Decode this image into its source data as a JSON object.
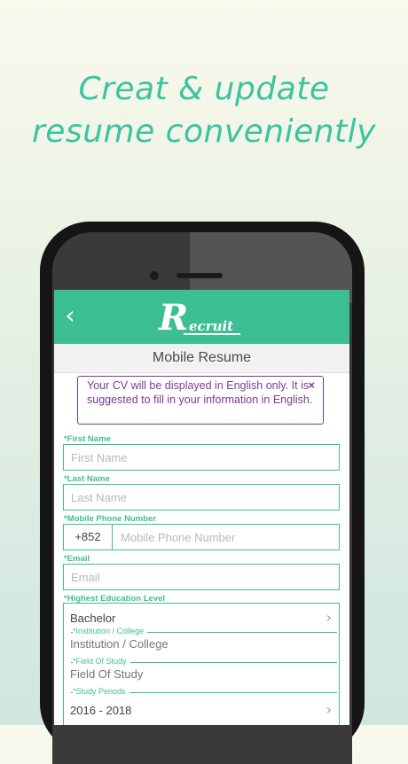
{
  "headline": {
    "line1": "Creat & update",
    "line2": "resume conveniently"
  },
  "colors": {
    "accent": "#3cbf93",
    "headline": "#3cc3a0",
    "notice": "#7a3c8e"
  },
  "app": {
    "back_icon": "chevron-left-icon",
    "logo_text": "ecruit",
    "logo_letter": "R",
    "screen_title": "Mobile Resume"
  },
  "notice": {
    "text": "Your CV will be displayed in English only. It is suggested to fill in your information in English.",
    "close_label": "×"
  },
  "form": {
    "first_name": {
      "label": "*First Name",
      "placeholder": "First Name"
    },
    "last_name": {
      "label": "*Last Name",
      "placeholder": "Last Name"
    },
    "mobile": {
      "label": "*Mobile Phone Number",
      "prefix": "+852",
      "placeholder": "Mobile Phone Number"
    },
    "email": {
      "label": "*Email",
      "placeholder": "Email"
    },
    "education": {
      "label": "*Highest Education Level",
      "level_value": "Bachelor",
      "institution_label": "*Institution / College",
      "institution_placeholder": "Institution / College",
      "field_label": "*Field Of Study",
      "field_placeholder": "Field Of Study",
      "period_label": "*Study Periods",
      "period_value": "2016 - 2018",
      "chevron_icon": "chevron-right-icon"
    }
  }
}
